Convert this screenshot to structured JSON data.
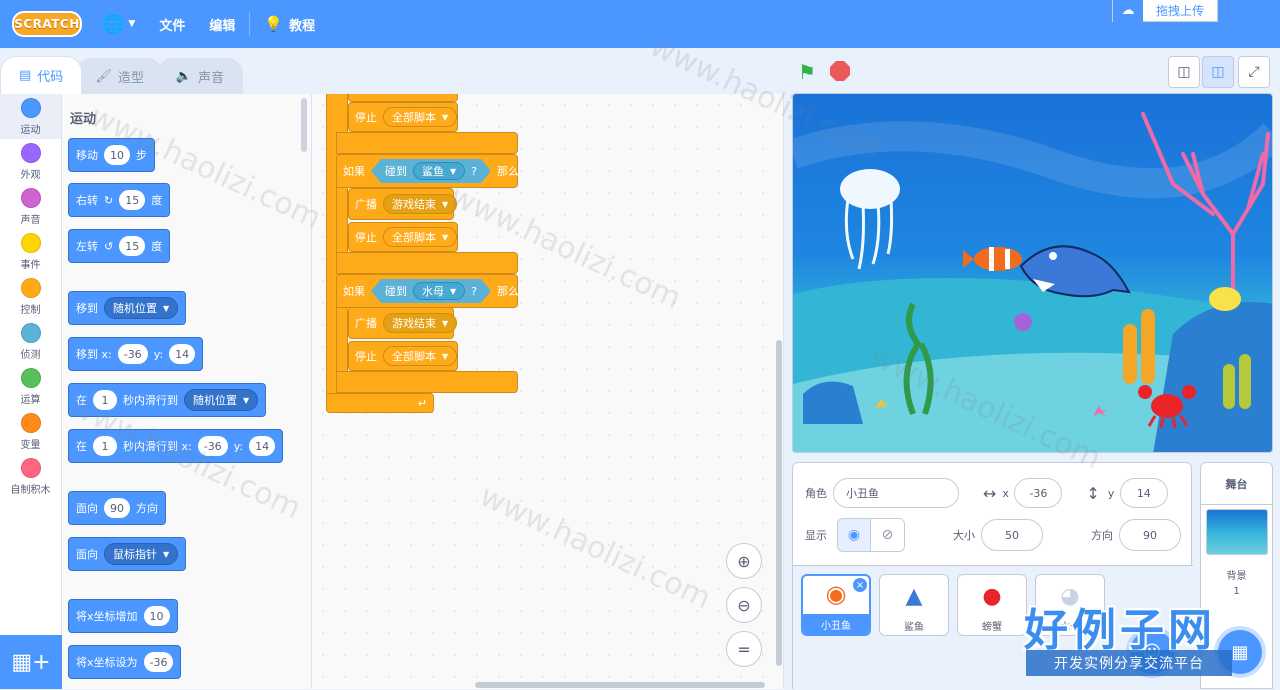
{
  "menubar": {
    "logo": "SCRATCH",
    "file": "文件",
    "edit": "编辑",
    "tutorials": "教程",
    "upload": "拖拽上传"
  },
  "tabs": {
    "code": "代码",
    "costumes": "造型",
    "sounds": "声音"
  },
  "categories": [
    {
      "label": "运动",
      "color": "#4c97ff"
    },
    {
      "label": "外观",
      "color": "#9966ff"
    },
    {
      "label": "声音",
      "color": "#cf63cf"
    },
    {
      "label": "事件",
      "color": "#ffd500"
    },
    {
      "label": "控制",
      "color": "#ffab19"
    },
    {
      "label": "侦测",
      "color": "#5cb1d6"
    },
    {
      "label": "运算",
      "color": "#59c059"
    },
    {
      "label": "变量",
      "color": "#ff8c1a"
    },
    {
      "label": "自制积木",
      "color": "#ff6680"
    }
  ],
  "palette": {
    "title": "运动",
    "move": {
      "a": "移动",
      "v": "10",
      "b": "步"
    },
    "turn_right": {
      "a": "右转",
      "v": "15",
      "b": "度"
    },
    "turn_left": {
      "a": "左转",
      "v": "15",
      "b": "度"
    },
    "goto": {
      "a": "移到",
      "opt": "随机位置"
    },
    "goto_xy": {
      "a": "移到 x:",
      "x": "-36",
      "yl": "y:",
      "y": "14"
    },
    "glide": {
      "a": "在",
      "v": "1",
      "b": "秒内滑行到",
      "opt": "随机位置"
    },
    "glide_xy": {
      "a": "在",
      "v": "1",
      "b": "秒内滑行到 x:",
      "x": "-36",
      "yl": "y:",
      "y": "14"
    },
    "point_dir": {
      "a": "面向",
      "v": "90",
      "b": "方向"
    },
    "point_towards": {
      "a": "面向",
      "opt": "鼠标指针"
    },
    "change_x": {
      "a": "将x坐标增加",
      "v": "10"
    },
    "set_x": {
      "a": "将x坐标设为",
      "v": "-36"
    }
  },
  "script": {
    "stop": "停止",
    "all_scripts": "全部脚本",
    "if": "如果",
    "touching": "碰到",
    "shark": "鲨鱼",
    "q": "?",
    "then": "那么",
    "broadcast": "广播",
    "game_over": "游戏结束",
    "jellyfish": "水母"
  },
  "sprite_info": {
    "sprite_label": "角色",
    "sprite_name": "小丑鱼",
    "x_label": "x",
    "x": "-36",
    "y_label": "y",
    "y": "14",
    "show_label": "显示",
    "size_label": "大小",
    "size": "50",
    "direction_label": "方向",
    "direction": "90"
  },
  "sprites": [
    {
      "name": "小丑鱼",
      "icon": "clownfish"
    },
    {
      "name": "鲨鱼",
      "icon": "shark"
    },
    {
      "name": "螃蟹",
      "icon": "crab"
    },
    {
      "name": "水母",
      "icon": "jellyfish"
    }
  ],
  "stage_pane": {
    "title": "舞台",
    "backdrop_label": "背景",
    "backdrop_count": "1"
  },
  "watermark": {
    "text": "www.haolizi.com",
    "brand": "好例子网",
    "slogan": "开发实例分享交流平台"
  }
}
